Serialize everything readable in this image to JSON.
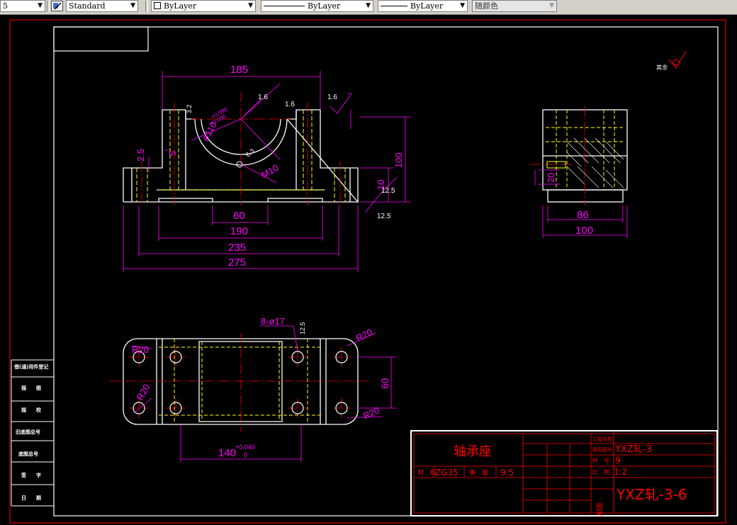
{
  "toolbar": {
    "layer_value": "5",
    "text_style": "Standard",
    "color": "ByLayer",
    "linetype": "ByLayer",
    "lineweight": "ByLayer",
    "plot_style": "随颜色"
  },
  "drawing": {
    "roughness_note_label": "其余",
    "front_view": {
      "dims": [
        "185",
        "2.5",
        "5",
        "100",
        "10",
        "12.5",
        "12.5",
        "60",
        "190",
        "235",
        "275",
        "M10"
      ],
      "roughness": [
        "3.2",
        "1.6",
        "1.6",
        "1.6",
        "6.3"
      ],
      "bore_diameter": "ø110",
      "bore_tol_upper": "+0.090",
      "bore_tol_lower": "+0.036"
    },
    "side_view": {
      "dims": [
        "20",
        "86",
        "100"
      ]
    },
    "top_view": {
      "holes": "8-ø17",
      "roughness": "12.5",
      "dims": [
        "R20",
        "R20",
        "R20",
        "R20",
        "60"
      ],
      "width_dim": "140",
      "width_tol_upper": "+0.040",
      "width_tol_lower": "0"
    }
  },
  "side_table": {
    "labels": [
      "借(通)用件登记",
      "描　　图",
      "描　　校",
      "旧底图总号",
      "底图总号",
      "签　　字",
      "日　　期"
    ]
  },
  "title_block": {
    "part_name": "轴承座",
    "material_label": "材　料",
    "material": "ZG35",
    "weight_label": "重　量",
    "weight": "9.5",
    "project_label": "工程名称",
    "project_no_label": "装配图号",
    "project_no": "YXZ轧-3",
    "item_label": "件　号",
    "item": "9",
    "scale_label": "比　例",
    "scale": "1:2",
    "drawing_no_label": "图号",
    "drawing_no": "YXZ轧-3-6"
  },
  "colors": {
    "background": "#000000",
    "geometry": "#ffffff",
    "hidden": "#ffff00",
    "center": "#ff0000",
    "dimension": "#ff00ff",
    "toolbar": "#d4d0c8"
  }
}
